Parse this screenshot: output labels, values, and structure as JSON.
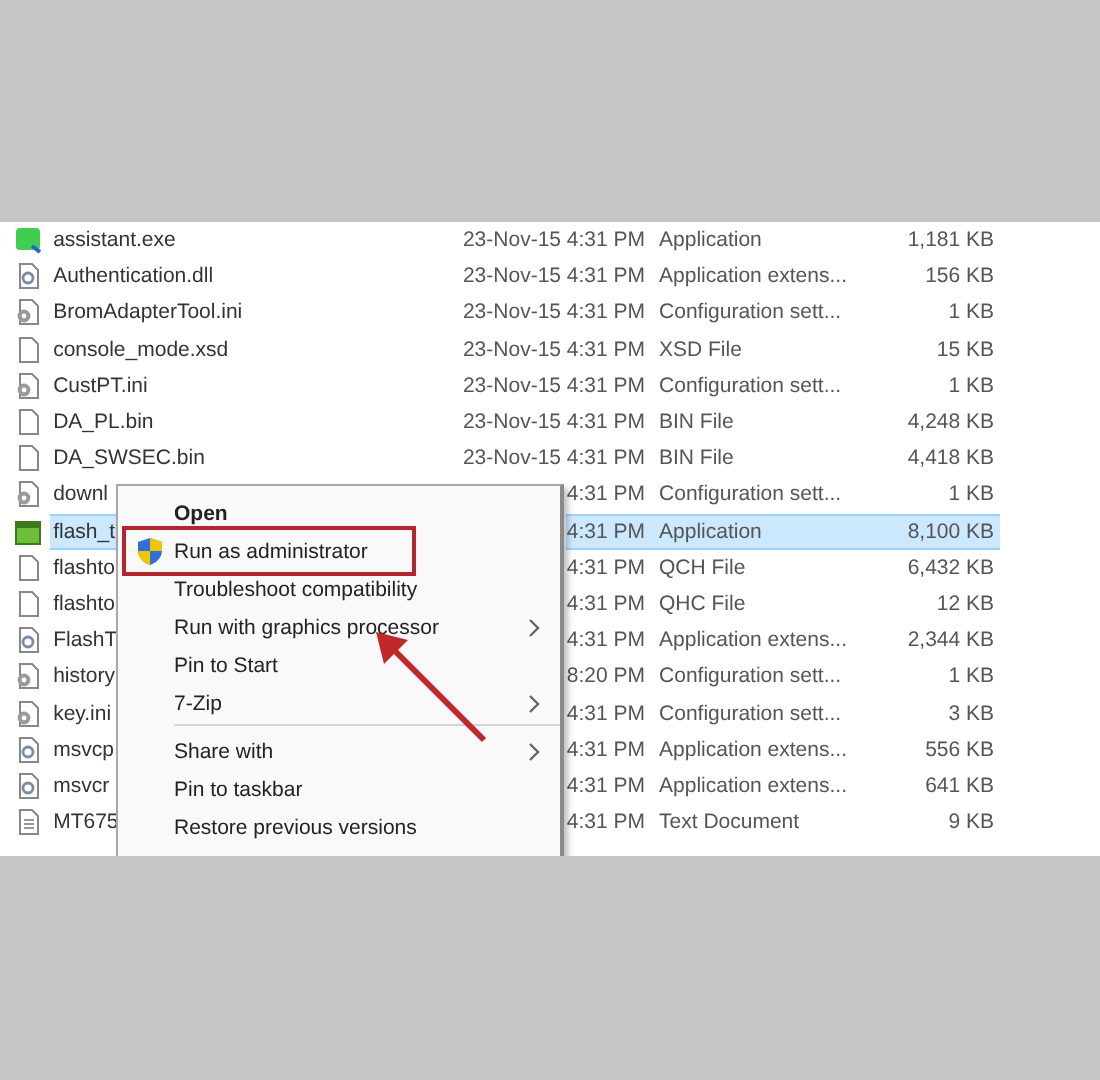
{
  "files": [
    {
      "name": "assistant.exe",
      "kind": "qt",
      "modified": "23-Nov-15 4:31 PM",
      "type": "Application",
      "size": "1,181 KB",
      "selected": false
    },
    {
      "name": "Authentication.dll",
      "kind": "extension",
      "modified": "23-Nov-15 4:31 PM",
      "type": "Application extens...",
      "size": "156 KB",
      "selected": false
    },
    {
      "name": "BromAdapterTool.ini",
      "kind": "config",
      "modified": "23-Nov-15 4:31 PM",
      "type": "Configuration sett...",
      "size": "1 KB",
      "selected": false
    },
    {
      "name": "console_mode.xsd",
      "kind": "blank",
      "modified": "23-Nov-15 4:31 PM",
      "type": "XSD File",
      "size": "15 KB",
      "selected": false
    },
    {
      "name": "CustPT.ini",
      "kind": "config",
      "modified": "23-Nov-15 4:31 PM",
      "type": "Configuration sett...",
      "size": "1 KB",
      "selected": false
    },
    {
      "name": "DA_PL.bin",
      "kind": "blank",
      "modified": "23-Nov-15 4:31 PM",
      "type": "BIN File",
      "size": "4,248 KB",
      "selected": false
    },
    {
      "name": "DA_SWSEC.bin",
      "kind": "blank",
      "modified": "23-Nov-15 4:31 PM",
      "type": "BIN File",
      "size": "4,418 KB",
      "selected": false
    },
    {
      "name": "downl",
      "kind": "config",
      "modified": "4:31 PM",
      "type": "Configuration sett...",
      "size": "1 KB",
      "selected": false
    },
    {
      "name": "flash_t",
      "kind": "app",
      "modified": "4:31 PM",
      "type": "Application",
      "size": "8,100 KB",
      "selected": true
    },
    {
      "name": "flashto",
      "kind": "blank",
      "modified": "4:31 PM",
      "type": "QCH File",
      "size": "6,432 KB",
      "selected": false
    },
    {
      "name": "flashto",
      "kind": "blank",
      "modified": "4:31 PM",
      "type": "QHC File",
      "size": "12 KB",
      "selected": false
    },
    {
      "name": "FlashT",
      "kind": "extension",
      "modified": "4:31 PM",
      "type": "Application extens...",
      "size": "2,344 KB",
      "selected": false
    },
    {
      "name": "history",
      "kind": "config",
      "modified": "8:20 PM",
      "type": "Configuration sett...",
      "size": "1 KB",
      "selected": false
    },
    {
      "name": "key.ini",
      "kind": "config",
      "modified": "4:31 PM",
      "type": "Configuration sett...",
      "size": "3 KB",
      "selected": false
    },
    {
      "name": "msvcp",
      "kind": "extension",
      "modified": "4:31 PM",
      "type": "Application extens...",
      "size": "556 KB",
      "selected": false
    },
    {
      "name": "msvcr",
      "kind": "extension",
      "modified": "4:31 PM",
      "type": "Application extens...",
      "size": "641 KB",
      "selected": false
    },
    {
      "name": "MT675",
      "kind": "text",
      "modified": "4:31 PM",
      "type": "Text Document",
      "size": "9 KB",
      "selected": false
    }
  ],
  "context_menu": [
    {
      "label": "Open",
      "kind": "default",
      "annotated": false,
      "shield": false,
      "submenu": false,
      "separator_before": false
    },
    {
      "label": "Run as administrator",
      "kind": "normal",
      "annotated": true,
      "shield": true,
      "submenu": false,
      "separator_before": false
    },
    {
      "label": "Troubleshoot compatibility",
      "kind": "normal",
      "annotated": false,
      "shield": false,
      "submenu": false,
      "separator_before": false
    },
    {
      "label": "Run with graphics processor",
      "kind": "normal",
      "annotated": false,
      "shield": false,
      "submenu": true,
      "separator_before": false
    },
    {
      "label": "Pin to Start",
      "kind": "normal",
      "annotated": false,
      "shield": false,
      "submenu": false,
      "separator_before": false
    },
    {
      "label": "7-Zip",
      "kind": "normal",
      "annotated": false,
      "shield": false,
      "submenu": true,
      "separator_before": false
    },
    {
      "label": "Share with",
      "kind": "normal",
      "annotated": false,
      "shield": false,
      "submenu": true,
      "separator_before": true
    },
    {
      "label": "Pin to taskbar",
      "kind": "normal",
      "annotated": false,
      "shield": false,
      "submenu": false,
      "separator_before": false
    },
    {
      "label": "Restore previous versions",
      "kind": "normal",
      "annotated": false,
      "shield": false,
      "submenu": false,
      "separator_before": false
    }
  ]
}
